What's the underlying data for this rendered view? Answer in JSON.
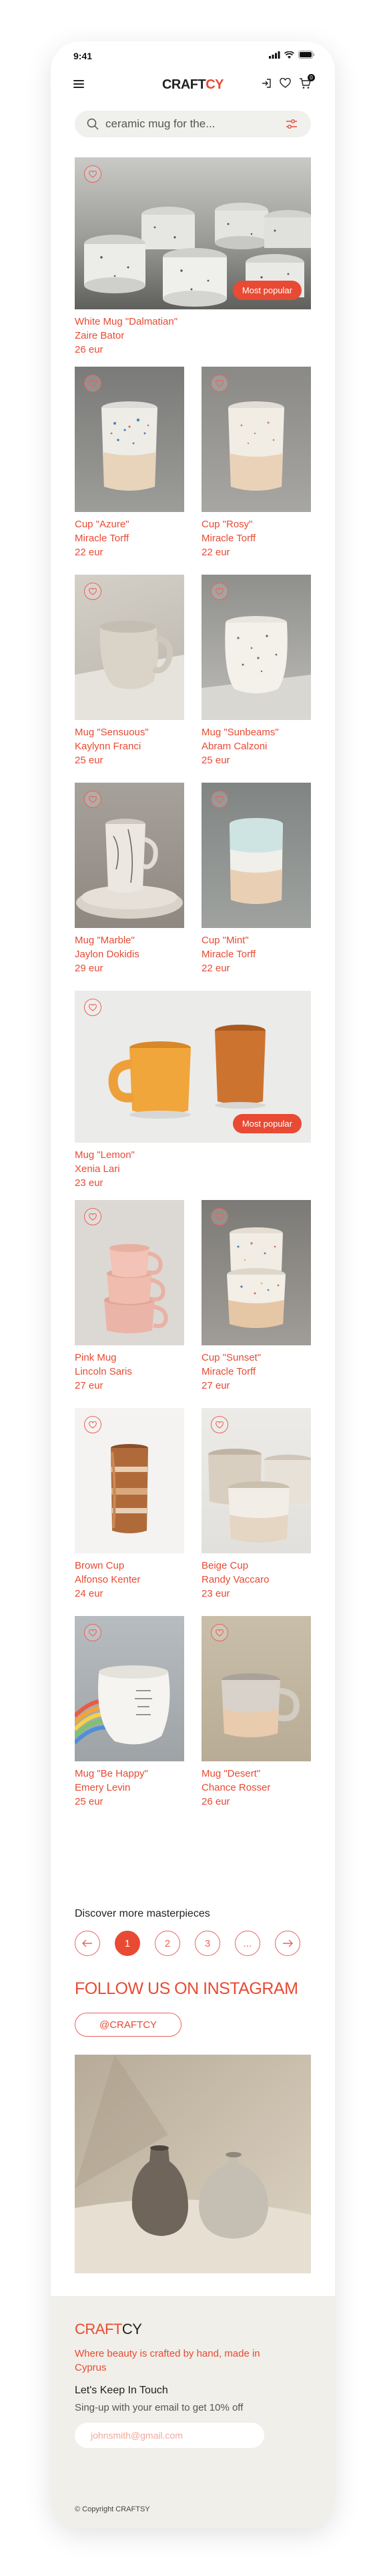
{
  "status": {
    "time": "9:41"
  },
  "header": {
    "logo_part1": "CRAFT",
    "logo_part2": "CY",
    "cart_count": "0"
  },
  "search": {
    "value": "ceramic mug for the..."
  },
  "products": [
    {
      "name": "White Mug \"Dalmatian\"",
      "maker": "Zaire Bator",
      "price": "26 eur",
      "badge": "Most popular"
    },
    {
      "name": "Cup \"Azure\"",
      "maker": "Miracle Torff",
      "price": "22 eur"
    },
    {
      "name": "Cup \"Rosy\"",
      "maker": "Miracle Torff",
      "price": "22 eur"
    },
    {
      "name": "Mug \"Sensuous\"",
      "maker": "Kaylynn Franci",
      "price": "25 eur"
    },
    {
      "name": "Mug \"Sunbeams\"",
      "maker": "Abram Calzoni",
      "price": "25 eur"
    },
    {
      "name": "Mug \"Marble\"",
      "maker": "Jaylon Dokidis",
      "price": "29 eur"
    },
    {
      "name": "Cup \"Mint\"",
      "maker": "Miracle Torff",
      "price": "22 eur"
    },
    {
      "name": "Mug \"Lemon\"",
      "maker": "Xenia Lari",
      "price": "23 eur",
      "badge": "Most popular"
    },
    {
      "name": "Pink Mug",
      "maker": "Lincoln Saris",
      "price": "27 eur"
    },
    {
      "name": "Cup \"Sunset\"",
      "maker": "Miracle Torff",
      "price": "27 eur"
    },
    {
      "name": "Brown Cup",
      "maker": "Alfonso Kenter",
      "price": "24 eur"
    },
    {
      "name": "Beige Cup",
      "maker": "Randy Vaccaro",
      "price": "23 eur"
    },
    {
      "name": "Mug \"Be Happy\"",
      "maker": "Emery Levin",
      "price": "25 eur"
    },
    {
      "name": "Mug \"Desert\"",
      "maker": "Chance Rosser",
      "price": "26 eur"
    }
  ],
  "pagination": {
    "title": "Discover more masterpieces",
    "pages": [
      "1",
      "2",
      "3",
      "..."
    ],
    "active": "1"
  },
  "instagram": {
    "title": "FOLLOW US ON INSTAGRAM",
    "handle": "@CRAFTCY"
  },
  "footer": {
    "logo_part1": "CRAFT",
    "logo_part2": "CY",
    "tagline": "Where beauty is crafted by hand, made in Cyprus",
    "touch_title": "Let's Keep In Touch",
    "signup": "Sing-up with your email to get 10% off",
    "email_placeholder": "johnsmith@gmail.com",
    "copyright": "© Copyright CRAFTSY"
  }
}
